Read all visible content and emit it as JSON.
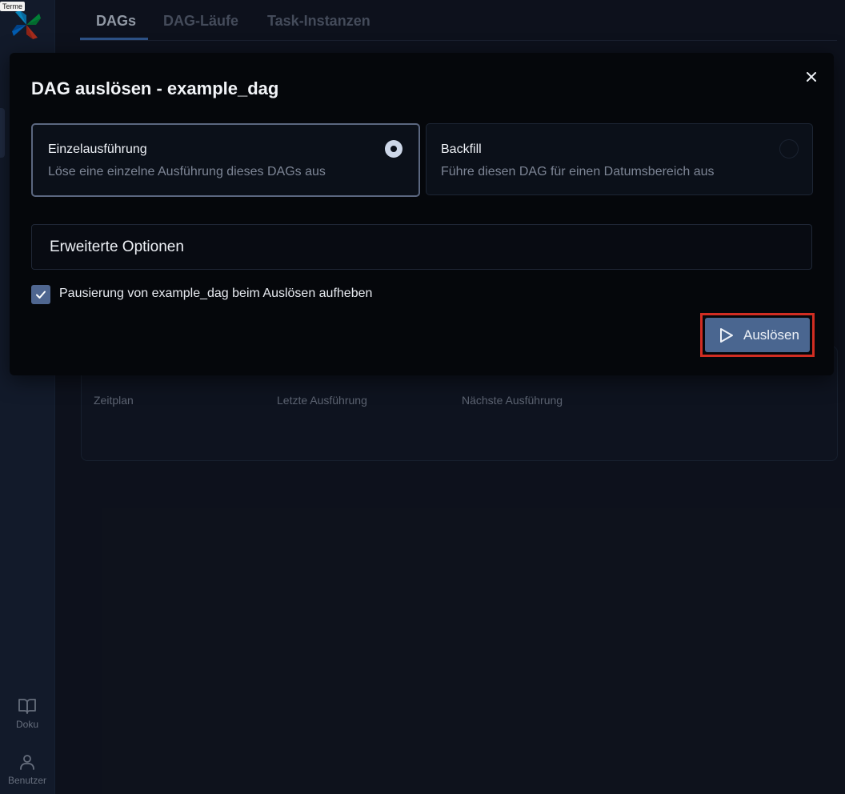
{
  "tooltip": "Terme",
  "sidebar": {
    "docs_label": "Doku",
    "user_label": "Benutzer"
  },
  "tabs": [
    {
      "label": "DAGs",
      "active": true
    },
    {
      "label": "DAG-Läufe",
      "active": false
    },
    {
      "label": "Task-Instanzen",
      "active": false
    }
  ],
  "background_table": {
    "columns": [
      "Zeitplan",
      "Letzte Ausführung",
      "Nächste Ausführung"
    ]
  },
  "modal": {
    "title": "DAG auslösen - example_dag",
    "options": [
      {
        "title": "Einzelausführung",
        "description": "Löse eine einzelne Ausführung dieses DAGs aus",
        "selected": true
      },
      {
        "title": "Backfill",
        "description": "Führe diesen DAG für einen Datumsbereich aus",
        "selected": false
      }
    ],
    "advanced_label": "Erweiterte Optionen",
    "unpause_checkbox_label": "Pausierung von example_dag beim Auslösen aufheben",
    "unpause_checked": true,
    "trigger_label": "Auslösen"
  },
  "colors": {
    "accent": "#4a6690",
    "highlight": "#d12d22",
    "background": "#111622"
  }
}
